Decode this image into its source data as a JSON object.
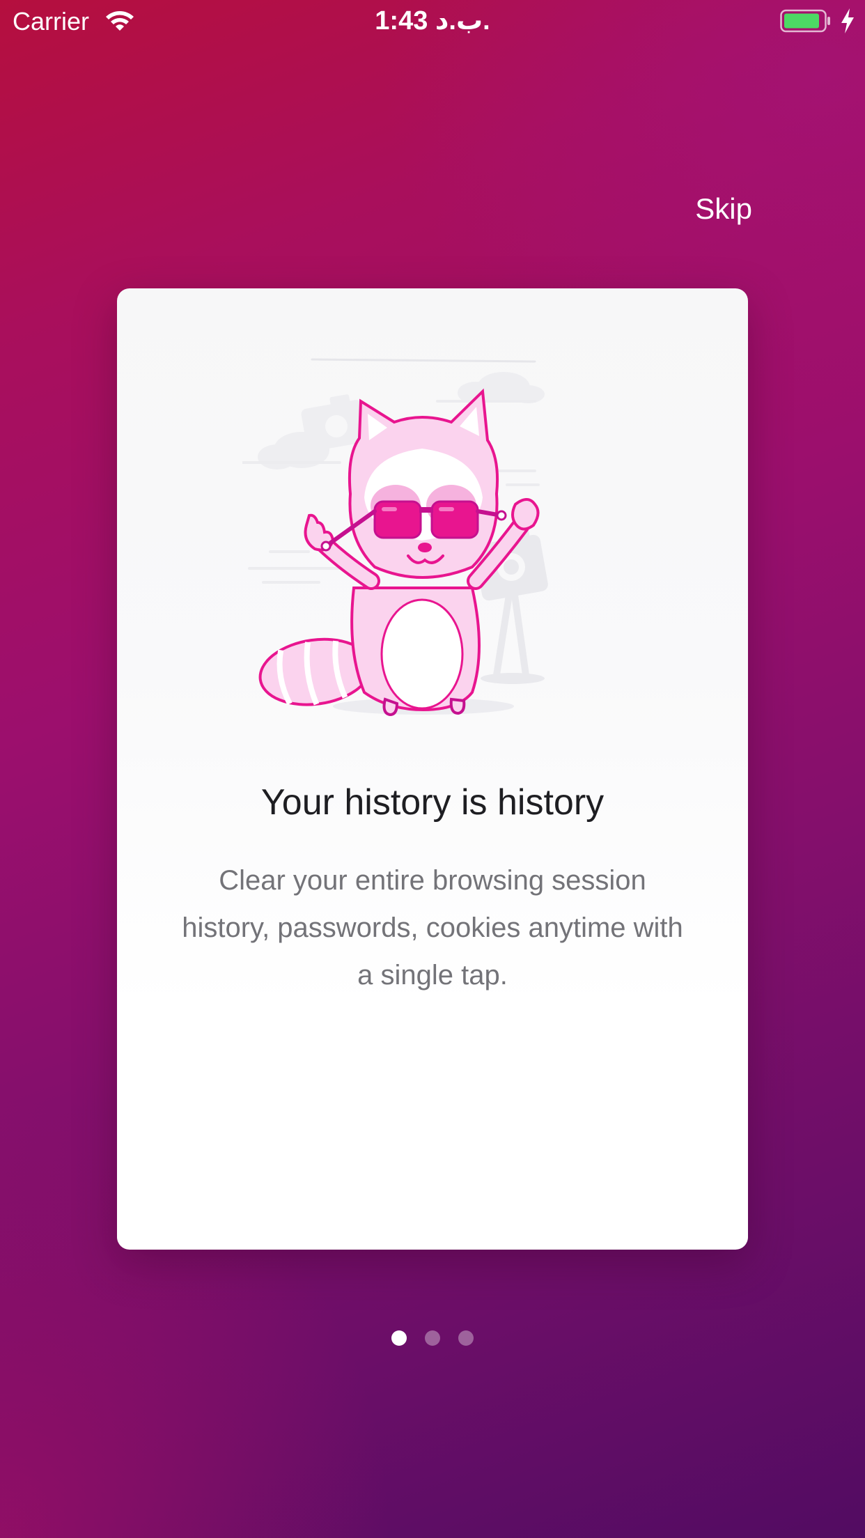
{
  "status_bar": {
    "carrier": "Carrier",
    "time": "1:43 ب.د.",
    "battery_color": "#4cd964"
  },
  "skip_label": "Skip",
  "card": {
    "illustration_icon": "raccoon-sunglasses-illustration",
    "title": "Your history is history",
    "description": "Clear your entire browsing session history, passwords, cookies anytime with a single tap."
  },
  "pagination": {
    "count": 3,
    "active_index": 0
  },
  "colors": {
    "background_start": "#b50f3e",
    "background_end": "#520c62",
    "accent_pink": "#e8158f"
  }
}
